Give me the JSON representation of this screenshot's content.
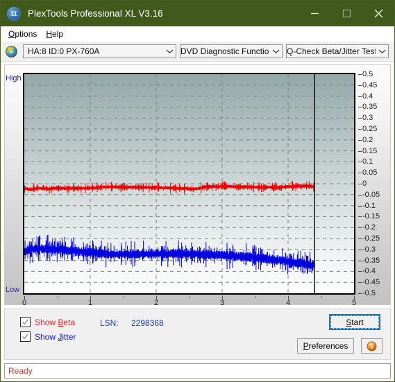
{
  "window": {
    "title": "PlexTools Professional XL V3.16",
    "app_icon": "xl-logo-icon",
    "minimize_label": "minimize-icon",
    "maximize_label": "maximize-icon",
    "close_label": "close-icon",
    "titlebar_color": "#415a1b"
  },
  "menu": {
    "items": [
      {
        "label": "Options",
        "accel": "O"
      },
      {
        "label": "Help",
        "accel": "H"
      }
    ]
  },
  "toolbar": {
    "disc_icon": "compact-disc-icon",
    "drive_select": "HA:8 ID:0  PX-760A",
    "function_select": "DVD Diagnostic Functions",
    "test_select": "Q-Check Beta/Jitter Test"
  },
  "controls": {
    "show_beta_label": "Show Beta",
    "show_beta_checked": true,
    "show_jitter_label": "Show Jitter",
    "show_jitter_checked": true,
    "lsn_label": "LSN:",
    "lsn_value": "2298368",
    "start_label": "Start",
    "preferences_label": "Preferences",
    "info_label": "info-icon"
  },
  "status": {
    "text": "Ready",
    "color": "#e03030"
  },
  "chart_data": {
    "type": "line",
    "title": "Q-Check Beta/Jitter Test",
    "xlabel": "",
    "ylabel": "",
    "xlim": [
      0,
      5
    ],
    "ylim": [
      -0.5,
      0.5
    ],
    "xticks": [
      0,
      1,
      2,
      3,
      4,
      5
    ],
    "yticks": [
      0.5,
      0.45,
      0.4,
      0.35,
      0.3,
      0.25,
      0.2,
      0.15,
      0.1,
      0.05,
      0,
      -0.05,
      -0.1,
      -0.15,
      -0.2,
      -0.25,
      -0.3,
      -0.35,
      -0.4,
      -0.45,
      -0.5
    ],
    "ytick_labels": [
      "0.5",
      "0.45",
      "0.4",
      "0.35",
      "0.3",
      "0.25",
      "0.2",
      "0.15",
      "0.1",
      "0.05",
      "0",
      "-0.05",
      "-0.1",
      "-0.15",
      "-0.2",
      "-0.25",
      "-0.3",
      "-0.35",
      "-0.4",
      "-0.45",
      "-0.5"
    ],
    "axis_top_label": "High",
    "axis_bottom_label": "Low",
    "grid": true,
    "legend_position": "below-plot",
    "data_end_x": 4.4,
    "marker_line_x": 4.4,
    "series": [
      {
        "name": "Beta",
        "color": "#ee0000",
        "x_start": 0,
        "x_end": 4.4,
        "mean_level": -0.018,
        "band_half_width": 0.012,
        "control_points": [
          [
            0.0,
            -0.022
          ],
          [
            0.1,
            -0.026
          ],
          [
            0.2,
            -0.02
          ],
          [
            0.35,
            -0.023
          ],
          [
            0.5,
            -0.02
          ],
          [
            0.7,
            -0.021
          ],
          [
            0.9,
            -0.021
          ],
          [
            1.1,
            -0.018
          ],
          [
            1.25,
            -0.014
          ],
          [
            1.45,
            -0.015
          ],
          [
            1.7,
            -0.016
          ],
          [
            1.95,
            -0.017
          ],
          [
            2.2,
            -0.019
          ],
          [
            2.45,
            -0.023
          ],
          [
            2.6,
            -0.024
          ],
          [
            2.72,
            -0.016
          ],
          [
            2.9,
            -0.012
          ],
          [
            3.1,
            -0.013
          ],
          [
            3.35,
            -0.014
          ],
          [
            3.6,
            -0.016
          ],
          [
            3.85,
            -0.017
          ],
          [
            4.05,
            -0.013
          ],
          [
            4.2,
            -0.01
          ],
          [
            4.4,
            -0.012
          ]
        ]
      },
      {
        "name": "Jitter",
        "color": "#0000e0",
        "x_start": 0,
        "x_end": 4.4,
        "mean_level": -0.325,
        "band_half_width": 0.03,
        "control_points": [
          [
            0.0,
            -0.31
          ],
          [
            0.1,
            -0.3
          ],
          [
            0.2,
            -0.298
          ],
          [
            0.35,
            -0.296
          ],
          [
            0.5,
            -0.3
          ],
          [
            0.7,
            -0.305
          ],
          [
            0.9,
            -0.312
          ],
          [
            1.1,
            -0.316
          ],
          [
            1.25,
            -0.32
          ],
          [
            1.45,
            -0.322
          ],
          [
            1.7,
            -0.322
          ],
          [
            1.95,
            -0.32
          ],
          [
            2.2,
            -0.319
          ],
          [
            2.45,
            -0.321
          ],
          [
            2.6,
            -0.323
          ],
          [
            2.8,
            -0.324
          ],
          [
            3.0,
            -0.326
          ],
          [
            3.2,
            -0.33
          ],
          [
            3.4,
            -0.334
          ],
          [
            3.6,
            -0.34
          ],
          [
            3.8,
            -0.347
          ],
          [
            4.0,
            -0.355
          ],
          [
            4.2,
            -0.364
          ],
          [
            4.4,
            -0.372
          ]
        ]
      }
    ]
  }
}
